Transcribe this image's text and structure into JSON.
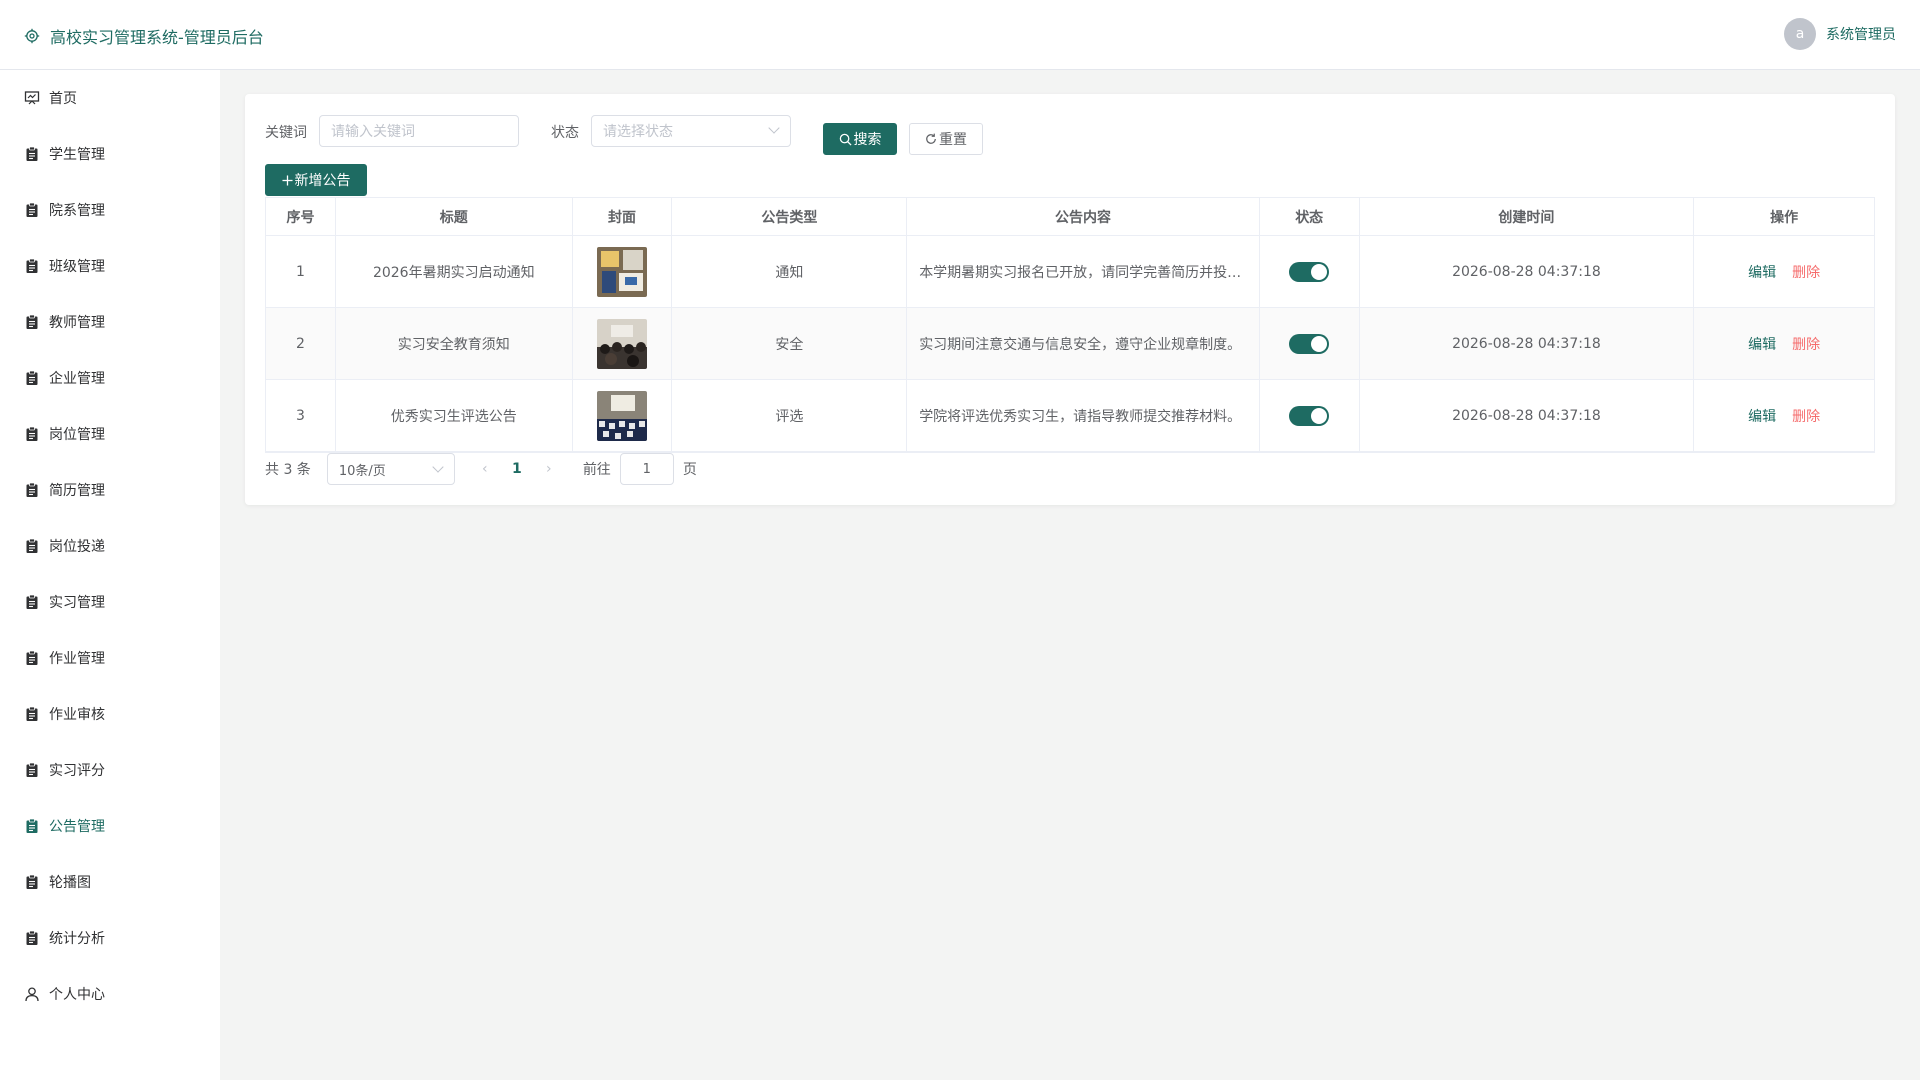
{
  "header": {
    "title": "高校实习管理系统-管理员后台",
    "avatar_letter": "a",
    "username": "系统管理员"
  },
  "sidebar": {
    "items": [
      {
        "label": "首页",
        "icon": "dashboard-icon",
        "active": false
      },
      {
        "label": "学生管理",
        "icon": "clipboard-icon",
        "active": false
      },
      {
        "label": "院系管理",
        "icon": "clipboard-icon",
        "active": false
      },
      {
        "label": "班级管理",
        "icon": "clipboard-icon",
        "active": false
      },
      {
        "label": "教师管理",
        "icon": "clipboard-icon",
        "active": false
      },
      {
        "label": "企业管理",
        "icon": "clipboard-icon",
        "active": false
      },
      {
        "label": "岗位管理",
        "icon": "clipboard-icon",
        "active": false
      },
      {
        "label": "简历管理",
        "icon": "clipboard-icon",
        "active": false
      },
      {
        "label": "岗位投递",
        "icon": "clipboard-icon",
        "active": false
      },
      {
        "label": "实习管理",
        "icon": "clipboard-icon",
        "active": false
      },
      {
        "label": "作业管理",
        "icon": "clipboard-icon",
        "active": false
      },
      {
        "label": "作业审核",
        "icon": "clipboard-icon",
        "active": false
      },
      {
        "label": "实习评分",
        "icon": "clipboard-icon",
        "active": false
      },
      {
        "label": "公告管理",
        "icon": "clipboard-icon",
        "active": true
      },
      {
        "label": "轮播图",
        "icon": "clipboard-icon",
        "active": false
      },
      {
        "label": "统计分析",
        "icon": "clipboard-icon",
        "active": false
      },
      {
        "label": "个人中心",
        "icon": "user-icon",
        "active": false
      }
    ]
  },
  "filters": {
    "keyword_label": "关键词",
    "keyword_placeholder": "请输入关键词",
    "status_label": "状态",
    "status_placeholder": "请选择状态",
    "search_label": "搜索",
    "reset_label": "重置",
    "add_label": "新增公告"
  },
  "table": {
    "columns": [
      "序号",
      "标题",
      "封面",
      "公告类型",
      "公告内容",
      "状态",
      "创建时间",
      "操作"
    ],
    "rows": [
      {
        "index": "1",
        "title": "2026年暑期实习启动通知",
        "type": "通知",
        "content": "本学期暑期实习报名已开放，请同学完善简历并投…",
        "enabled": true,
        "created": "2026-08-28 04:37:18"
      },
      {
        "index": "2",
        "title": "实习安全教育须知",
        "type": "安全",
        "content": "实习期间注意交通与信息安全，遵守企业规章制度。",
        "enabled": true,
        "created": "2026-08-28 04:37:18"
      },
      {
        "index": "3",
        "title": "优秀实习生评选公告",
        "type": "评选",
        "content": "学院将评选优秀实习生，请指导教师提交推荐材料。",
        "enabled": true,
        "created": "2026-08-28 04:37:18"
      }
    ],
    "edit_label": "编辑",
    "delete_label": "删除"
  },
  "pagination": {
    "total_text": "共 3 条",
    "page_size": "10条/页",
    "current_page": "1",
    "goto_label": "前往",
    "goto_value": "1",
    "page_suffix": "页"
  },
  "colors": {
    "primary": "#1e6b62",
    "danger": "#f56c6c"
  }
}
